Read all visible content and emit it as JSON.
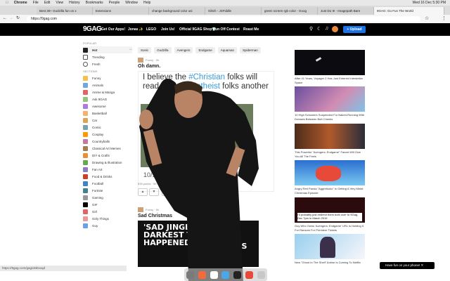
{
  "menubar": {
    "app": "Chrome",
    "items": [
      "File",
      "Edit",
      "View",
      "History",
      "Bookmarks",
      "People",
      "Window",
      "Help"
    ],
    "clock": "Wed 16 Dec 5:30 PM"
  },
  "tabs": [
    "Best 30+ Godzilla fun on x",
    "Extensions",
    "change background color usi",
    "Glitch - JSFiddle",
    "green screen rgb color - Goog",
    "Just Do It! - Imagepath Bare",
    "9GAG: Go Fun The World"
  ],
  "address": {
    "url": "https://9gag.com"
  },
  "nav": {
    "logo": "9GAG",
    "links": [
      "Get Our Apps!",
      "Jonas ✨",
      "LEGO",
      "Join Us!",
      "Official 9GAG Shop👕",
      "Fun Off Contest",
      "Roast Me"
    ],
    "upload": "+ Upload"
  },
  "sidebar": {
    "popular_heading": "POPULAR",
    "popular": [
      "Hot",
      "Trending",
      "Fresh"
    ],
    "sections_heading": "SECTIONS",
    "sections": [
      "Funny",
      "Animals",
      "Anime & Manga",
      "Ask 9GAG",
      "Awesome",
      "Basketball",
      "Car",
      "Comic",
      "Cosplay",
      "Countryballs",
      "Classical Art Memes",
      "DIY & Crafts",
      "Drawing & Illustration",
      "Fan Art",
      "Food & Drinks",
      "Football",
      "Fortnite",
      "Gaming",
      "GIF",
      "Girl",
      "Girly Things",
      "Guy"
    ]
  },
  "chips": [
    "Sonic",
    "Godzilla",
    "Avengers",
    "Endgame",
    "Aquaman",
    "Spiderman"
  ],
  "post1": {
    "meta": "Funny · 9h",
    "title": "Oh damn.",
    "tweet_a": "I believe the ",
    "tweet_b": "#Christian",
    "tweet_c": " folks will read this one ",
    "tweet_d": "#atheist",
    "tweet_e": " folks another",
    "date": "10/10/1",
    "points": "836 points · 56 comments"
  },
  "post2": {
    "meta": "Funny · 9h",
    "title": "Sad Christmas",
    "meme_line1": "'SAD JINGLE B",
    "meme_line2": "DARKEST TH",
    "meme_line3": "HAPPENED",
    "meme_tail": "MAS"
  },
  "right": [
    {
      "caption": "After 41 Years, Voyager 2 Has Just Entered Interstellar Space"
    },
    {
      "caption": "10 High Schoolers Suspended For Naked-Running With Dresses Between Butt Cheeks"
    },
    {
      "caption": "This Powerful \"Avengers: Endgame\" Fanart Will Give You All The Feels"
    },
    {
      "caption": "Angry Red Panda \"Aggretsuko\" Is Getting A Very Metal Christmas Episode"
    },
    {
      "caption": "Guy Who Owns 'Avengers: Endgame' URL Is Holding It For Ransom For Premiere Tickets"
    },
    {
      "caption": "New \"Ghost In The Shell\" Anime Is Coming To Netflix"
    }
  ],
  "right_inline_text": "I'll probably just redirect them both over to 9Gag, Dec 7pm in March 2019",
  "status": {
    "url": "https://9gag.com/gag/aNbxxqd"
  },
  "fun": {
    "label": "Have fun on your phone! ✕"
  }
}
